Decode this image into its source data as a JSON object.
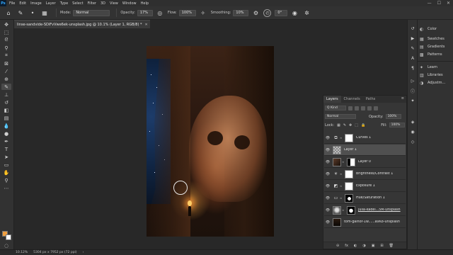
{
  "menubar": {
    "logo": "Ps",
    "items": [
      "File",
      "Edit",
      "Image",
      "Layer",
      "Type",
      "Select",
      "Filter",
      "3D",
      "View",
      "Window",
      "Help"
    ],
    "win_min": "—",
    "win_max": "☐",
    "win_close": "✕"
  },
  "options": {
    "mode_label": "Mode:",
    "mode_value": "Normal",
    "opacity_label": "Opacity:",
    "opacity_value": "17%",
    "flow_label": "Flow:",
    "flow_value": "100%",
    "smoothing_label": "Smoothing:",
    "smoothing_value": "10%",
    "angle_value": "0°"
  },
  "document": {
    "tab_title": "linse-sandvide-SDiFvVwe6ek-unsplash.jpg @ 10.1% (Layer 1, RGB/8) *",
    "tab_close": "✕"
  },
  "colors": {
    "foreground": "#f0a040",
    "background": "#ffffff"
  },
  "status": {
    "zoom": "10.12%",
    "doc_info": "5304 px x 7952 px (72 ppi)"
  },
  "right_panels": [
    {
      "icon": "color-icon",
      "glyph": "◐",
      "label": "Color"
    },
    {
      "icon": "swatches-icon",
      "glyph": "▦",
      "label": "Swatches"
    },
    {
      "icon": "gradients-icon",
      "glyph": "▤",
      "label": "Gradients"
    },
    {
      "icon": "patterns-icon",
      "glyph": "▩",
      "label": "Patterns"
    },
    {
      "icon": "learn-icon",
      "glyph": "✦",
      "label": "Learn"
    },
    {
      "icon": "libraries-icon",
      "glyph": "▥",
      "label": "Libraries"
    },
    {
      "icon": "adjustments-icon",
      "glyph": "◑",
      "label": "Adjustm..."
    }
  ],
  "layers_panel": {
    "tabs": [
      "Layers",
      "Channels",
      "Paths"
    ],
    "kind_label": "Q Kind",
    "blend_mode": "Normal",
    "opacity_label": "Opacity:",
    "opacity_value": "100%",
    "lock_label": "Lock:",
    "fill_label": "Fill:",
    "fill_value": "100%",
    "menu_glyph": "≡",
    "layers": [
      {
        "name": "Curves 1",
        "type": "adjustment",
        "glyph": "⧉",
        "visible": true,
        "selected": false
      },
      {
        "name": "Layer 1",
        "type": "pixel",
        "visible": true,
        "selected": true
      },
      {
        "name": "Layer 0",
        "type": "masked",
        "visible": true,
        "selected": false
      },
      {
        "name": "Brightness/Contrast 1",
        "type": "adjustment",
        "glyph": "☀",
        "visible": true,
        "selected": false
      },
      {
        "name": "Exposure 1",
        "type": "adjustment",
        "glyph": "◩",
        "visible": true,
        "selected": false
      },
      {
        "name": "Hue/Saturation 1",
        "type": "adjustment",
        "glyph": "▭",
        "visible": true,
        "selected": false
      },
      {
        "name": "julia-kadel...5M-unsplash",
        "type": "photo",
        "visible": true,
        "selected": false
      },
      {
        "name": "tom-gainor-1w......a9K8-unsplash",
        "type": "photo2",
        "visible": true,
        "selected": false
      }
    ],
    "footer": [
      "⊖",
      "fx",
      "◐",
      "◑",
      "▣",
      "⊞",
      "🗑"
    ]
  }
}
